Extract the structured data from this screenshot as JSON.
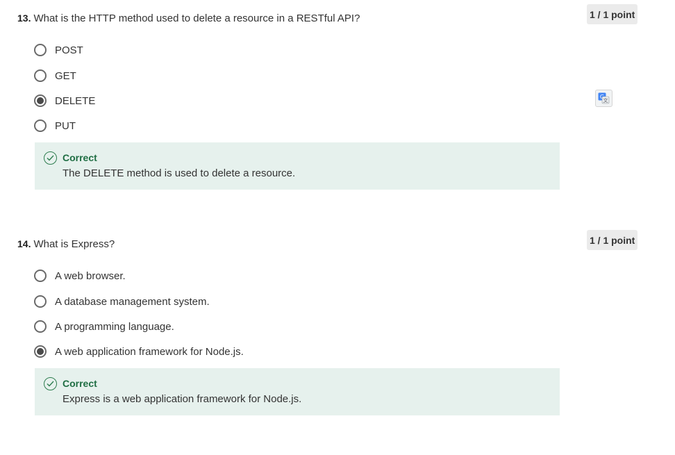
{
  "questions": [
    {
      "number": "13.",
      "text": "What is the HTTP method used to delete a resource in a RESTful API?",
      "points": "1 / 1 point",
      "options": [
        {
          "label": "POST",
          "selected": false
        },
        {
          "label": "GET",
          "selected": false
        },
        {
          "label": "DELETE",
          "selected": true
        },
        {
          "label": "PUT",
          "selected": false
        }
      ],
      "feedback": {
        "title": "Correct",
        "text": "The DELETE method is used to delete a resource."
      }
    },
    {
      "number": "14.",
      "text": "What is Express?",
      "points": "1 / 1 point",
      "options": [
        {
          "label": "A web browser.",
          "selected": false
        },
        {
          "label": "A database management system.",
          "selected": false
        },
        {
          "label": "A programming language.",
          "selected": false
        },
        {
          "label": "A web application framework for Node.js.",
          "selected": true
        }
      ],
      "feedback": {
        "title": "Correct",
        "text": "Express is a web application framework for Node.js."
      }
    }
  ],
  "icons": {
    "translate": "google-translate-icon",
    "feedback": "check-circle-icon"
  },
  "colors": {
    "feedback_bg": "#e6f1ed",
    "correct_text": "#1f6e43",
    "points_bg": "#ebebeb"
  }
}
